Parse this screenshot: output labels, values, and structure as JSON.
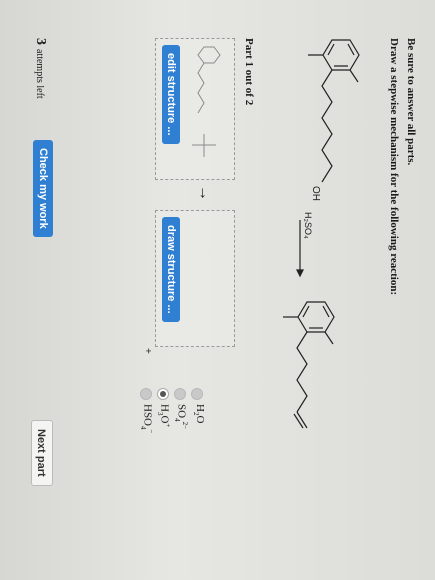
{
  "instructions": {
    "line1": "Be sure to answer all parts.",
    "line2": "Draw a stepwise mechanism for the following reaction:"
  },
  "reaction": {
    "reactant_group": "OH",
    "reagent": "H₂SO₄"
  },
  "part": {
    "label": "Part 1 out of 2"
  },
  "editor": {
    "edit_button": "edit structure ...",
    "draw_button": "draw structure ...",
    "arrow": "→",
    "plus": "+"
  },
  "options": [
    {
      "base": "H",
      "sub": "2",
      "base2": "O",
      "sup": "",
      "selected": false
    },
    {
      "base": "SO",
      "sub": "4",
      "base2": "",
      "sup": "2−",
      "selected": false
    },
    {
      "base": "H",
      "sub": "3",
      "base2": "O",
      "sup": "+",
      "selected": true
    },
    {
      "base": "HSO",
      "sub": "4",
      "base2": "",
      "sup": "−",
      "selected": false
    }
  ],
  "footer": {
    "attempts_count": "3",
    "attempts_text": "attempts left",
    "check_button": "Check my work",
    "next_button": "Next part"
  }
}
